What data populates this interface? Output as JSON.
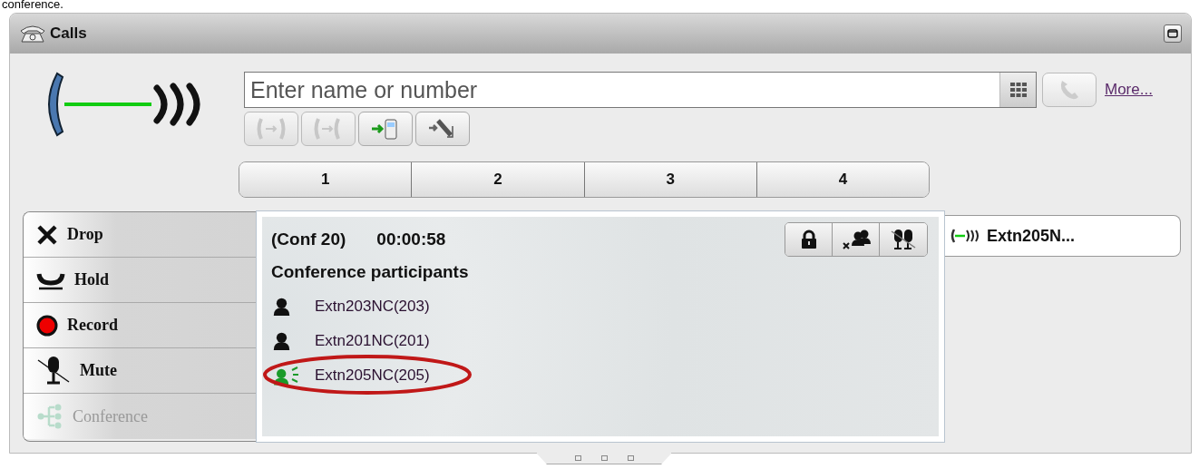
{
  "caption": "conference.",
  "window": {
    "title": "Calls"
  },
  "dial": {
    "placeholder": "Enter name or number",
    "more_link": "More..."
  },
  "tool_buttons": [
    {
      "kind": "transfer",
      "disabled": true
    },
    {
      "kind": "conference",
      "disabled": true
    },
    {
      "kind": "mobile",
      "disabled": false
    },
    {
      "kind": "hangup",
      "disabled": false
    }
  ],
  "tabs": [
    {
      "label": "1"
    },
    {
      "label": "2"
    },
    {
      "label": "3"
    },
    {
      "label": "4"
    }
  ],
  "actions": [
    {
      "kind": "drop",
      "label": "Drop",
      "disabled": false
    },
    {
      "kind": "hold",
      "label": "Hold",
      "disabled": false
    },
    {
      "kind": "record",
      "label": "Record",
      "disabled": false
    },
    {
      "kind": "mute",
      "label": "Mute",
      "disabled": false
    },
    {
      "kind": "conference",
      "label": "Conference",
      "disabled": true
    }
  ],
  "conference": {
    "name": "(Conf 20)",
    "duration": "00:00:58",
    "heading": "Conference participants",
    "tools": [
      {
        "kind": "lock"
      },
      {
        "kind": "remove"
      },
      {
        "kind": "mute-all"
      }
    ],
    "participants": [
      {
        "name": "Extn203NC(203)",
        "speaking": false,
        "circled": false
      },
      {
        "name": "Extn201NC(201)",
        "speaking": false,
        "circled": false
      },
      {
        "name": "Extn205NC(205)",
        "speaking": true,
        "circled": true
      }
    ]
  },
  "active_call": {
    "label": "Extn205N..."
  }
}
